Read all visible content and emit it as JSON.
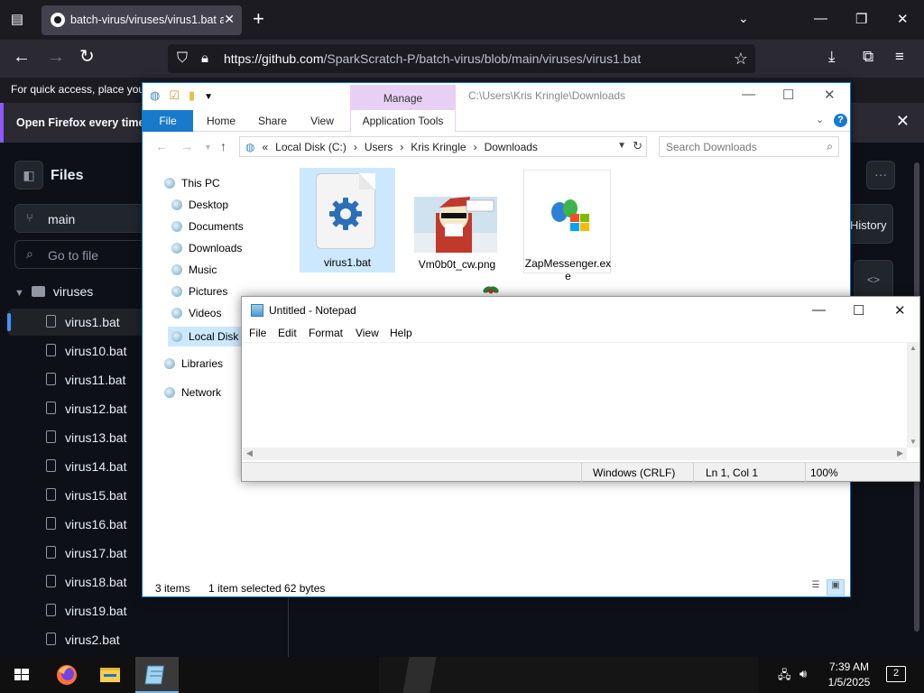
{
  "browser": {
    "tab_title": "batch-virus/viruses/virus1.bat a",
    "url_host": "https://github.com",
    "url_path": "/SparkScratch-P/batch-virus/blob/main/viruses/virus1.bat",
    "bookmark_notice": "For quick access, place your",
    "default_notice": "Open Firefox every time"
  },
  "github": {
    "files_title": "Files",
    "branch": "main",
    "goto_placeholder": "Go to file",
    "folder": "viruses",
    "files": [
      "virus1.bat",
      "virus10.bat",
      "virus11.bat",
      "virus12.bat",
      "virus13.bat",
      "virus14.bat",
      "virus15.bat",
      "virus16.bat",
      "virus17.bat",
      "virus18.bat",
      "virus19.bat",
      "virus2.bat"
    ],
    "history_label": "History",
    "more_label": "···"
  },
  "explorer": {
    "manage_tab": "Manage",
    "title_path": "C:\\Users\\Kris Kringle\\Downloads",
    "ribbon_tabs": [
      "File",
      "Home",
      "Share",
      "View",
      "Application Tools"
    ],
    "breadcrumb": [
      "«",
      "Local Disk (C:)",
      "›",
      "Users",
      "›",
      "Kris Kringle",
      "›",
      "Downloads"
    ],
    "search_placeholder": "Search Downloads",
    "nav": [
      "This PC",
      "Desktop",
      "Documents",
      "Downloads",
      "Music",
      "Pictures",
      "Videos",
      "Local Disk",
      "Libraries",
      "Network"
    ],
    "files": [
      {
        "name": "virus1.bat"
      },
      {
        "name": "Vm0b0t_cw.png"
      },
      {
        "name": "ZapMessenger.exe"
      }
    ],
    "status_items": "3 items",
    "status_selected": "1 item selected  62 bytes"
  },
  "notepad": {
    "title": "Untitled - Notepad",
    "menu": [
      "File",
      "Edit",
      "Format",
      "View",
      "Help"
    ],
    "content": "",
    "line_ending": "Windows (CRLF)",
    "position": "Ln 1, Col 1",
    "zoom": "100%"
  },
  "taskbar": {
    "time": "7:39 AM",
    "date": "1/5/2025",
    "notifications": "2"
  }
}
